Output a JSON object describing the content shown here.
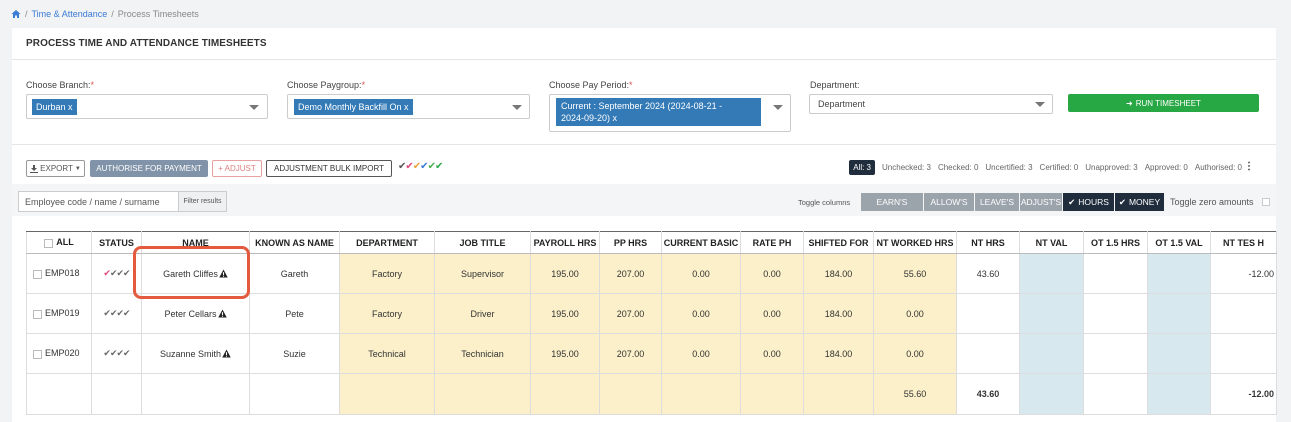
{
  "breadcrumb": {
    "sep": "/",
    "section": "Time & Attendance",
    "current": "Process Timesheets"
  },
  "page": {
    "title": "PROCESS TIME AND ATTENDANCE TIMESHEETS"
  },
  "form": {
    "branch": {
      "label": "Choose Branch:",
      "req": "*",
      "tag": "Durban x"
    },
    "paygroup": {
      "label": "Choose Paygroup:",
      "req": "*",
      "tag": "Demo Monthly Backfill On x"
    },
    "pay_period": {
      "label": "Choose Pay Period:",
      "req": "*",
      "tag_line1": "Current : September 2024 (2024-08-21 -",
      "tag_line2": "2024-09-20) x"
    },
    "department": {
      "label": "Department:",
      "value": "Department"
    },
    "run_label": "RUN TIMESHEET"
  },
  "toolbar": {
    "export": "EXPORT",
    "authorise": "AUTHORISE FOR PAYMENT",
    "adjust": "+ ADJUST",
    "bulk": "ADJUSTMENT BULK IMPORT",
    "check_colors": [
      "#555555",
      "#e0457b",
      "#e8a33d",
      "#3a7bd5",
      "#4caf50",
      "#28a745"
    ]
  },
  "status_filters": {
    "all": "All: 3",
    "unchecked": "Unchecked: 3",
    "checked": "Checked: 0",
    "uncertified": "Uncertified: 3",
    "certified": "Certified: 0",
    "unapproved": "Unapproved: 3",
    "approved": "Approved: 0",
    "authorised": "Authorised: 0"
  },
  "search": {
    "placeholder": "Employee code / name / surname",
    "filter_btn": "Filter results"
  },
  "toggle": {
    "label": "Toggle columns",
    "earns": "EARN'S",
    "allows": "ALLOW'S",
    "leaves": "LEAVE'S",
    "adjusts": "ADJUST'S",
    "hours": "HOURS",
    "money": "MONEY",
    "zero": "Toggle zero amounts"
  },
  "table": {
    "headers": {
      "all": "ALL",
      "status": "STATUS",
      "name": "NAME",
      "known_as": "KNOWN AS NAME",
      "department": "DEPARTMENT",
      "job_title": "JOB TITLE",
      "payroll_hrs": "PAYROLL HRS",
      "pp_hrs": "PP HRS",
      "current_basic": "CURRENT BASIC",
      "rate_ph": "RATE PH",
      "shifted_for": "SHIFTED FOR",
      "nt_worked_hrs": "NT WORKED HRS",
      "nt_hrs": "NT HRS",
      "nt_val": "NT VAL",
      "ot15_hrs": "OT 1.5 HRS",
      "ot15_val": "OT 1.5 VAL",
      "nt_tes": "NT TES H"
    },
    "rows": [
      {
        "code": "EMP018",
        "name": "Gareth Cliffes",
        "known": "Gareth",
        "dept": "Factory",
        "job": "Supervisor",
        "payroll": "195.00",
        "pp": "207.00",
        "basic": "0.00",
        "rate": "0.00",
        "shifted": "184.00",
        "ntw": "55.60",
        "nth": "43.60",
        "ntv": "",
        "ot15h": "",
        "ot15v": "",
        "ntt": "-12.00"
      },
      {
        "code": "EMP019",
        "name": "Peter Cellars",
        "known": "Pete",
        "dept": "Factory",
        "job": "Driver",
        "payroll": "195.00",
        "pp": "207.00",
        "basic": "0.00",
        "rate": "0.00",
        "shifted": "184.00",
        "ntw": "0.00",
        "nth": "",
        "ntv": "",
        "ot15h": "",
        "ot15v": "",
        "ntt": ""
      },
      {
        "code": "EMP020",
        "name": "Suzanne Smith",
        "known": "Suzie",
        "dept": "Technical",
        "job": "Technician",
        "payroll": "195.00",
        "pp": "207.00",
        "basic": "0.00",
        "rate": "0.00",
        "shifted": "184.00",
        "ntw": "0.00",
        "nth": "",
        "ntv": "",
        "ot15h": "",
        "ot15v": "",
        "ntt": ""
      }
    ],
    "totals": {
      "ntw": "55.60",
      "nth": "43.60",
      "ntt": "-12.00"
    }
  }
}
